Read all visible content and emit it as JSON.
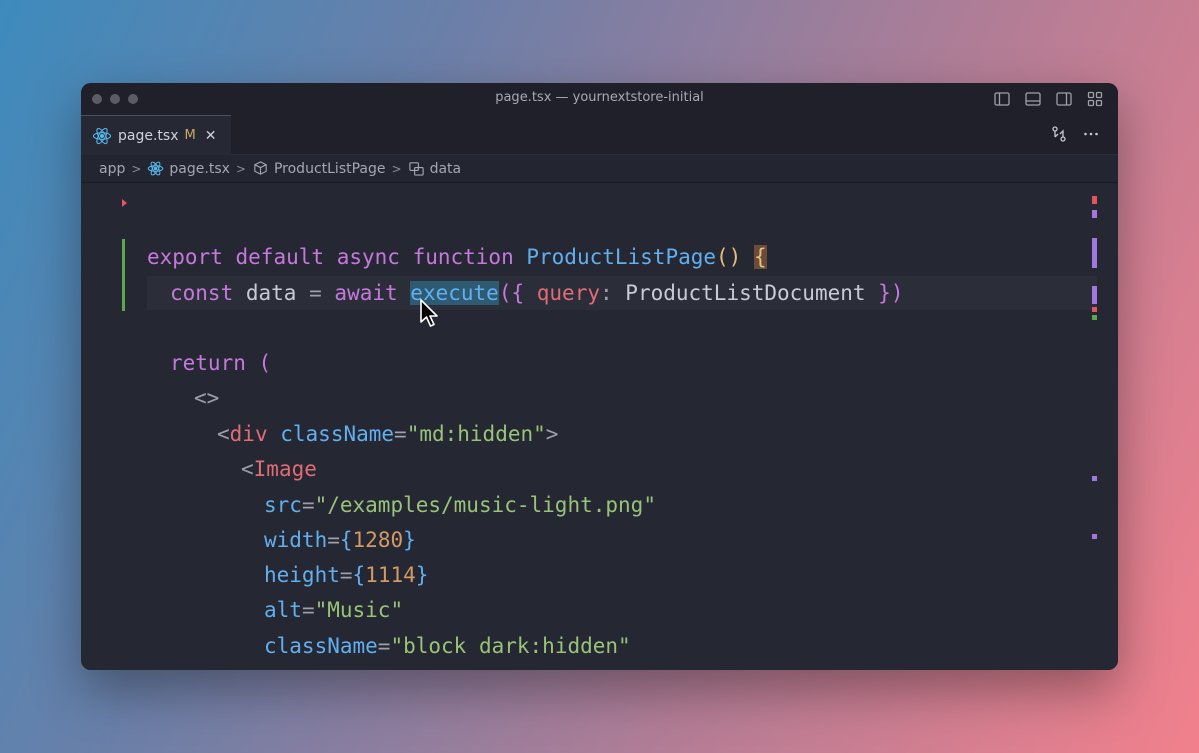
{
  "window": {
    "title": "page.tsx — yournextstore-initial"
  },
  "tab": {
    "label": "page.tsx",
    "modified": "M",
    "close": "✕"
  },
  "breadcrumb": {
    "items": [
      "app",
      "page.tsx",
      "ProductListPage",
      "data"
    ]
  },
  "code": {
    "l1": {
      "export": "export",
      "default": "default",
      "async": "async",
      "function": "function",
      "name": "ProductListPage",
      "parens": "()",
      "brace": "{"
    },
    "l2": {
      "const": "const",
      "var": "data",
      "eq": "=",
      "await": "await",
      "call": "execute",
      "open": "({",
      "key": "query",
      "colon": ":",
      "value": "ProductListDocument",
      "close": "})"
    },
    "l3": {
      "return": "return",
      "paren": "("
    },
    "l4": {
      "frag": "<>"
    },
    "l5": {
      "lt": "<",
      "tag": "div",
      "attr": "className",
      "eq": "=",
      "val": "\"md:hidden\"",
      "gt": ">"
    },
    "l6": {
      "lt": "<",
      "tag": "Image"
    },
    "l7": {
      "attr": "src",
      "eq": "=",
      "val": "\"/examples/music-light.png\""
    },
    "l8": {
      "attr": "width",
      "eq": "=",
      "open": "{",
      "val": "1280",
      "close": "}"
    },
    "l9": {
      "attr": "height",
      "eq": "=",
      "open": "{",
      "val": "1114",
      "close": "}"
    },
    "l10": {
      "attr": "alt",
      "eq": "=",
      "val": "\"Music\""
    },
    "l11": {
      "attr": "className",
      "eq": "=",
      "val": "\"block dark:hidden\""
    }
  },
  "colors": {
    "keyword": "#c678dd",
    "function": "#61afef",
    "string": "#98c379",
    "number": "#d19a66",
    "tag": "#e06c75"
  },
  "icons": [
    "react-icon",
    "close-icon",
    "source-control-icon",
    "more-icon",
    "component-icon",
    "variable-icon",
    "layout-icons"
  ]
}
